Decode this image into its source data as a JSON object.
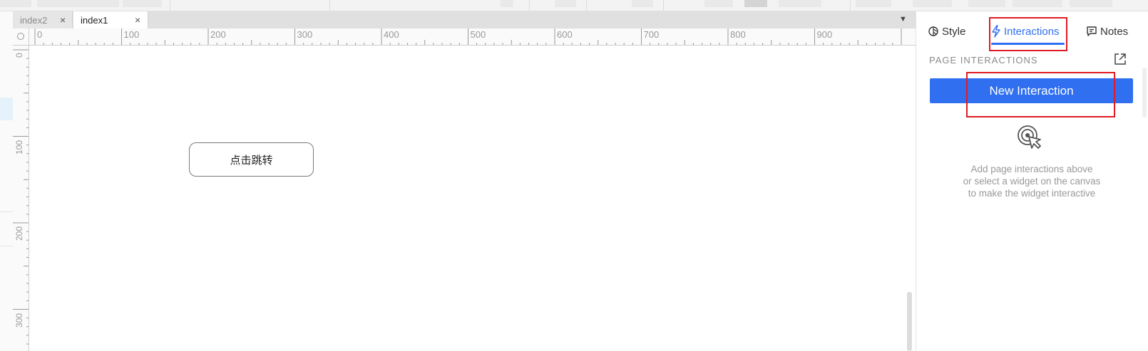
{
  "tabs": [
    {
      "label": "index2",
      "active": false
    },
    {
      "label": "index1",
      "active": true
    }
  ],
  "tab_close_glyph": "×",
  "tab_menu_glyph": "▼",
  "ruler": {
    "h_labels": [
      "0",
      "100",
      "200",
      "300",
      "400",
      "500",
      "600",
      "700",
      "800",
      "900"
    ],
    "v_labels": [
      "0",
      "100",
      "200",
      "300"
    ]
  },
  "canvas": {
    "widget_label": "点击跳转"
  },
  "panel": {
    "tabs": [
      {
        "label": "Style",
        "icon": "style-icon"
      },
      {
        "label": "Interactions",
        "icon": "lightning-icon"
      },
      {
        "label": "Notes",
        "icon": "notes-icon"
      }
    ],
    "active_tab": "Interactions",
    "section_title": "PAGE INTERACTIONS",
    "new_button": "New Interaction",
    "help_lines": [
      "Add page interactions above",
      "or select a widget on the canvas",
      "to make the widget interactive"
    ]
  },
  "colors": {
    "accent": "#2f6ff0",
    "highlight": "#e01b24"
  }
}
